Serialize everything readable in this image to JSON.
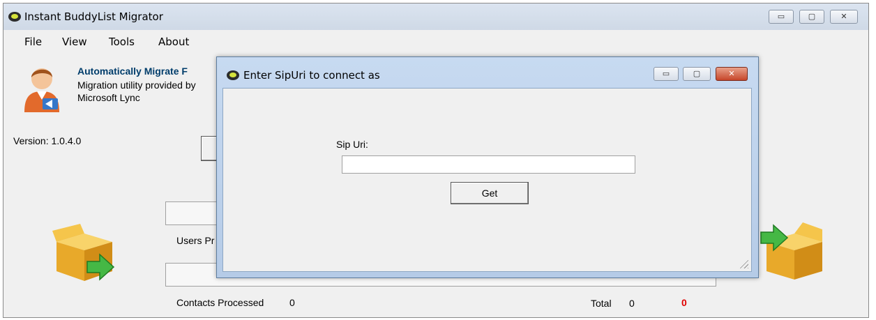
{
  "main_window": {
    "title": "Instant BuddyList Migrator",
    "caption_buttons": {
      "minimize": "▭",
      "maximize": "▢",
      "close": "✕"
    },
    "menu": [
      "File",
      "View",
      "Tools",
      "About"
    ],
    "header": {
      "title": "Automatically Migrate F",
      "description_line1": "Migration utility provided by",
      "description_line2": "Microsoft Lync"
    },
    "version": "Version: 1.0.4.0",
    "users_processed_label": "Users Pr",
    "contacts_processed_label": "Contacts Processed",
    "contacts_processed_value": "0",
    "total_label": "Total",
    "total_value": "0",
    "error_count": "0",
    "icons": [
      "user-icon",
      "box-import-icon",
      "box-export-icon",
      "app-icon"
    ],
    "colors": {
      "error_count": "#e00000",
      "header_title": "#003d6b"
    }
  },
  "dialog": {
    "title": "Enter SipUri to connect as",
    "caption_buttons": {
      "minimize": "▭",
      "maximize": "▢",
      "close": "✕"
    },
    "field_label": "Sip Uri:",
    "sip_uri_value": "",
    "get_button": "Get"
  }
}
